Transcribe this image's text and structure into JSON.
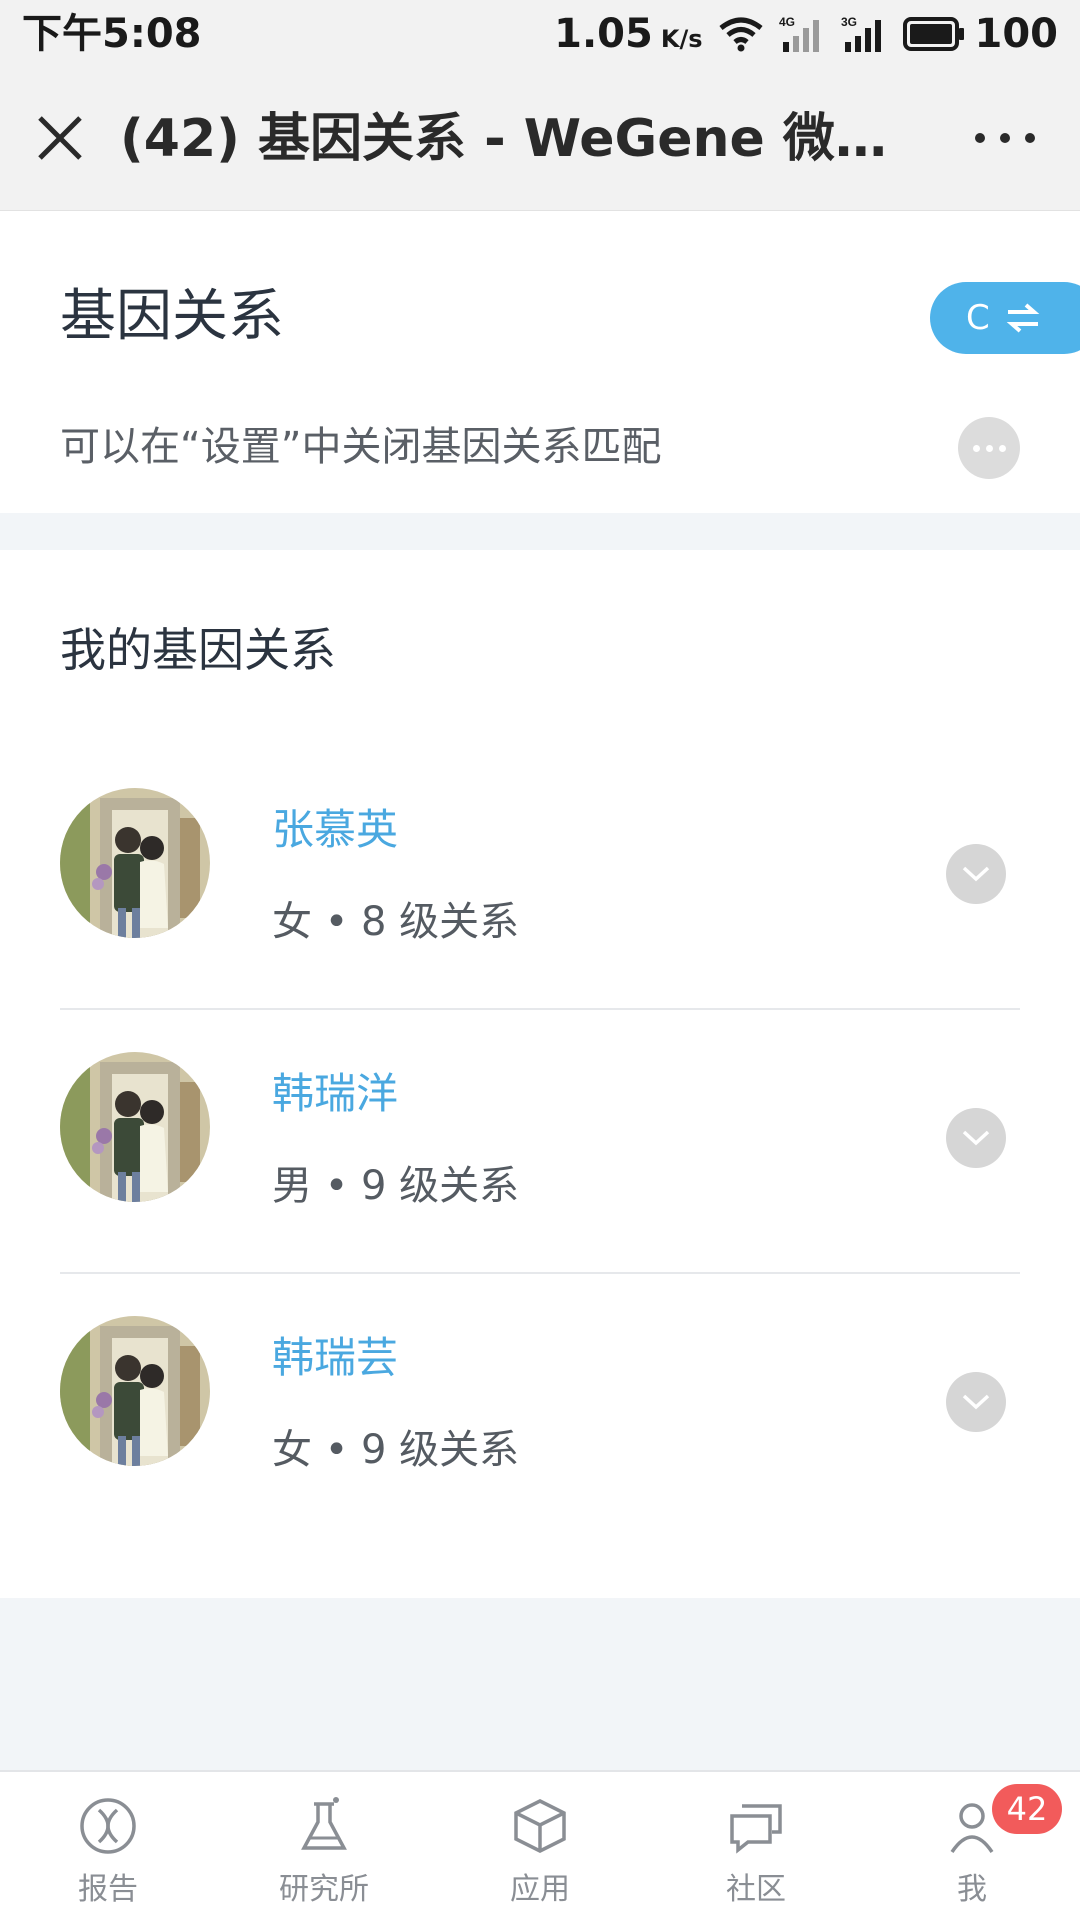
{
  "status_bar": {
    "time": "下午5:08",
    "speed": "1.05",
    "speed_unit": "K/s",
    "net_4g": "4G",
    "net_3g": "3G",
    "battery": "100"
  },
  "nav": {
    "title": "(42) 基因关系 - WeGene 微基因"
  },
  "header": {
    "title": "基因关系",
    "switch_label": "C",
    "hint": "可以在“设置”中关闭基因关系匹配"
  },
  "section": {
    "title": "我的基因关系"
  },
  "relatives": [
    {
      "name": "张慕英",
      "meta": "女 • 8 级关系"
    },
    {
      "name": "韩瑞洋",
      "meta": "男 • 9 级关系"
    },
    {
      "name": "韩瑞芸",
      "meta": "女 • 9 级关系"
    }
  ],
  "tabbar": {
    "items": [
      {
        "label": "报告",
        "icon": "dna-icon"
      },
      {
        "label": "研究所",
        "icon": "flask-icon"
      },
      {
        "label": "应用",
        "icon": "cube-icon"
      },
      {
        "label": "社区",
        "icon": "chat-icon"
      },
      {
        "label": "我",
        "icon": "person-icon"
      }
    ],
    "badge": "42"
  },
  "colors": {
    "accent": "#4fb3ea",
    "link": "#4aa8e0",
    "badge": "#f25b5b"
  }
}
